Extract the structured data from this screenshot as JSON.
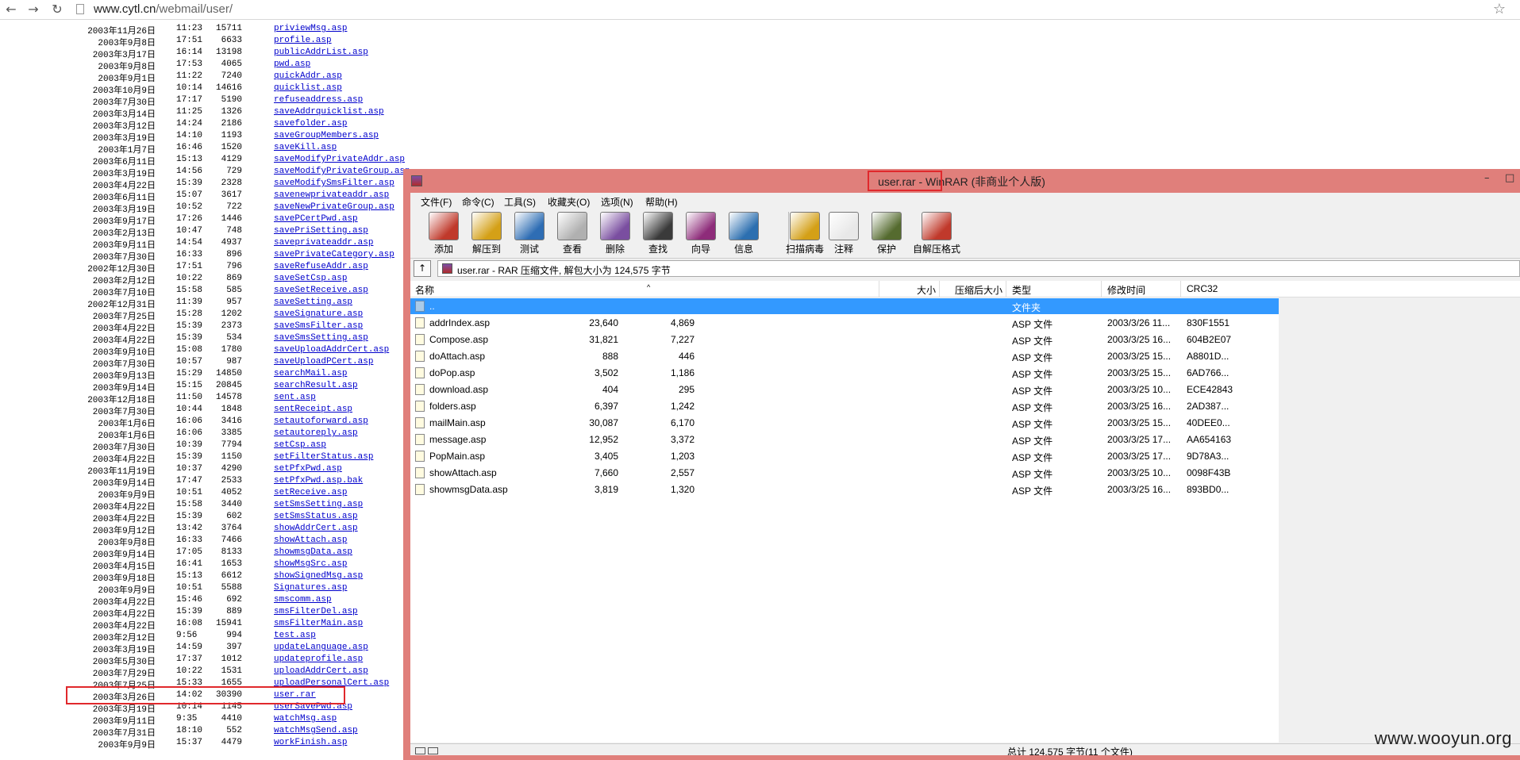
{
  "browser": {
    "url_host": "www.cytl.cn",
    "url_path": "/webmail/user/",
    "back_icon": "arrow-left",
    "forward_icon": "arrow-right",
    "reload_icon": "reload",
    "bookmark_icon": "star"
  },
  "listing": [
    {
      "date": "2003年11月26日",
      "time": "11:23",
      "size": "15711",
      "name": "priviewMsg.asp"
    },
    {
      "date": "2003年9月8日",
      "time": "17:51",
      "size": "6633",
      "name": "profile.asp"
    },
    {
      "date": "2003年3月17日",
      "time": "16:14",
      "size": "13198",
      "name": "publicAddrList.asp"
    },
    {
      "date": "2003年9月8日",
      "time": "17:53",
      "size": "4065",
      "name": "pwd.asp"
    },
    {
      "date": "2003年9月1日",
      "time": "11:22",
      "size": "7240",
      "name": "quickAddr.asp"
    },
    {
      "date": "2003年10月9日",
      "time": "10:14",
      "size": "14616",
      "name": "quicklist.asp"
    },
    {
      "date": "2003年7月30日",
      "time": "17:17",
      "size": "5190",
      "name": "refuseaddress.asp"
    },
    {
      "date": "2003年3月14日",
      "time": "11:25",
      "size": "1326",
      "name": "saveAddrquicklist.asp"
    },
    {
      "date": "2003年3月12日",
      "time": "14:24",
      "size": "2186",
      "name": "savefolder.asp"
    },
    {
      "date": "2003年3月19日",
      "time": "14:10",
      "size": "1193",
      "name": "saveGroupMembers.asp"
    },
    {
      "date": "2003年1月7日",
      "time": "16:46",
      "size": "1520",
      "name": "saveKill.asp"
    },
    {
      "date": "2003年6月11日",
      "time": "15:13",
      "size": "4129",
      "name": "saveModifyPrivateAddr.asp"
    },
    {
      "date": "2003年3月19日",
      "time": "14:56",
      "size": "729",
      "name": "saveModifyPrivateGroup.asp"
    },
    {
      "date": "2003年4月22日",
      "time": "15:39",
      "size": "2328",
      "name": "saveModifySmsFilter.asp"
    },
    {
      "date": "2003年6月11日",
      "time": "15:07",
      "size": "3617",
      "name": "savenewprivateaddr.asp"
    },
    {
      "date": "2003年3月19日",
      "time": "10:52",
      "size": "722",
      "name": "saveNewPrivateGroup.asp"
    },
    {
      "date": "2003年9月17日",
      "time": "17:26",
      "size": "1446",
      "name": "savePCertPwd.asp"
    },
    {
      "date": "2003年2月13日",
      "time": "10:47",
      "size": "748",
      "name": "savePriSetting.asp"
    },
    {
      "date": "2003年9月11日",
      "time": "14:54",
      "size": "4937",
      "name": "saveprivateaddr.asp"
    },
    {
      "date": "2003年7月30日",
      "time": "16:33",
      "size": "896",
      "name": "savePrivateCategory.asp"
    },
    {
      "date": "2002年12月30日",
      "time": "17:51",
      "size": "796",
      "name": "saveRefuseAddr.asp"
    },
    {
      "date": "2003年2月12日",
      "time": "10:22",
      "size": "869",
      "name": "saveSetCsp.asp"
    },
    {
      "date": "2003年7月10日",
      "time": "15:58",
      "size": "585",
      "name": "saveSetReceive.asp"
    },
    {
      "date": "2002年12月31日",
      "time": "11:39",
      "size": "957",
      "name": "saveSetting.asp"
    },
    {
      "date": "2003年7月25日",
      "time": "15:28",
      "size": "1202",
      "name": "saveSignature.asp"
    },
    {
      "date": "2003年4月22日",
      "time": "15:39",
      "size": "2373",
      "name": "saveSmsFilter.asp"
    },
    {
      "date": "2003年4月22日",
      "time": "15:39",
      "size": "534",
      "name": "saveSmsSetting.asp"
    },
    {
      "date": "2003年9月10日",
      "time": "15:08",
      "size": "1780",
      "name": "saveUploadAddrCert.asp"
    },
    {
      "date": "2003年7月30日",
      "time": "10:57",
      "size": "987",
      "name": "saveUploadPCert.asp"
    },
    {
      "date": "2003年9月13日",
      "time": "15:29",
      "size": "14850",
      "name": "searchMail.asp"
    },
    {
      "date": "2003年9月14日",
      "time": "15:15",
      "size": "20845",
      "name": "searchResult.asp"
    },
    {
      "date": "2003年12月18日",
      "time": "11:50",
      "size": "14578",
      "name": "sent.asp"
    },
    {
      "date": "2003年7月30日",
      "time": "10:44",
      "size": "1848",
      "name": "sentReceipt.asp"
    },
    {
      "date": "2003年1月6日",
      "time": "16:06",
      "size": "3416",
      "name": "setautoforward.asp"
    },
    {
      "date": "2003年1月6日",
      "time": "16:06",
      "size": "3385",
      "name": "setautoreply.asp"
    },
    {
      "date": "2003年7月30日",
      "time": "10:39",
      "size": "7794",
      "name": "setCsp.asp"
    },
    {
      "date": "2003年4月22日",
      "time": "15:39",
      "size": "1150",
      "name": "setFilterStatus.asp"
    },
    {
      "date": "2003年11月19日",
      "time": "10:37",
      "size": "4290",
      "name": "setPfxPwd.asp"
    },
    {
      "date": "2003年9月14日",
      "time": "17:47",
      "size": "2533",
      "name": "setPfxPwd.asp.bak"
    },
    {
      "date": "2003年9月9日",
      "time": "10:51",
      "size": "4052",
      "name": "setReceive.asp"
    },
    {
      "date": "2003年4月22日",
      "time": "15:58",
      "size": "3440",
      "name": "setSmsSetting.asp"
    },
    {
      "date": "2003年4月22日",
      "time": "15:39",
      "size": "602",
      "name": "setSmsStatus.asp"
    },
    {
      "date": "2003年9月12日",
      "time": "13:42",
      "size": "3764",
      "name": "showAddrCert.asp"
    },
    {
      "date": "2003年9月8日",
      "time": "16:33",
      "size": "7466",
      "name": "showAttach.asp"
    },
    {
      "date": "2003年9月14日",
      "time": "17:05",
      "size": "8133",
      "name": "showmsgData.asp"
    },
    {
      "date": "2003年4月15日",
      "time": "16:41",
      "size": "1653",
      "name": "showMsgSrc.asp"
    },
    {
      "date": "2003年9月18日",
      "time": "15:13",
      "size": "6612",
      "name": "showSignedMsg.asp"
    },
    {
      "date": "2003年9月9日",
      "time": "10:51",
      "size": "5588",
      "name": "Signatures.asp"
    },
    {
      "date": "2003年4月22日",
      "time": "15:46",
      "size": "692",
      "name": "smscomm.asp"
    },
    {
      "date": "2003年4月22日",
      "time": "15:39",
      "size": "889",
      "name": "smsFilterDel.asp"
    },
    {
      "date": "2003年4月22日",
      "time": "16:08",
      "size": "15941",
      "name": "smsFilterMain.asp"
    },
    {
      "date": "2003年2月12日",
      "time": "9:56",
      "size": "994",
      "name": "test.asp"
    },
    {
      "date": "2003年3月19日",
      "time": "14:59",
      "size": "397",
      "name": "updateLanguage.asp"
    },
    {
      "date": "2003年5月30日",
      "time": "17:37",
      "size": "1012",
      "name": "updateprofile.asp"
    },
    {
      "date": "2003年7月29日",
      "time": "10:22",
      "size": "1531",
      "name": "uploadAddrCert.asp"
    },
    {
      "date": "2003年7月25日",
      "time": "15:33",
      "size": "1655",
      "name": "uploadPersonalCert.asp"
    },
    {
      "date": "2003年3月26日",
      "time": "14:02",
      "size": "30390",
      "name": "user.rar"
    },
    {
      "date": "2003年3月19日",
      "time": "10:14",
      "size": "1145",
      "name": "userSavePwd.asp"
    },
    {
      "date": "2003年9月11日",
      "time": "9:35",
      "size": "4410",
      "name": "watchMsg.asp"
    },
    {
      "date": "2003年7月31日",
      "time": "18:10",
      "size": "552",
      "name": "watchMsgSend.asp"
    },
    {
      "date": "2003年9月9日",
      "time": "15:37",
      "size": "4479",
      "name": "workFinish.asp"
    }
  ],
  "winrar": {
    "title_file": "user.rar",
    "title_rest": " - WinRAR (非商业个人版)",
    "min_label": "–",
    "max_label": "□",
    "menu": [
      "文件(F)",
      "命令(C)",
      "工具(S)",
      "收藏夹(O)",
      "选项(N)",
      "帮助(H)"
    ],
    "tools": [
      {
        "label": "添加",
        "icon": "add-icon",
        "color": "#c0392b"
      },
      {
        "label": "解压到",
        "icon": "extract-to-icon",
        "color": "#d4a017"
      },
      {
        "label": "测试",
        "icon": "test-icon",
        "color": "#2e6db4"
      },
      {
        "label": "查看",
        "icon": "view-icon",
        "color": "#b0b0b0"
      },
      {
        "label": "删除",
        "icon": "delete-icon",
        "color": "#7a4ea0"
      },
      {
        "label": "查找",
        "icon": "find-icon",
        "color": "#3a3a3a"
      },
      {
        "label": "向导",
        "icon": "wizard-icon",
        "color": "#8e2c7a"
      },
      {
        "label": "信息",
        "icon": "info-icon",
        "color": "#2c6fb0"
      },
      {
        "label": "扫描病毒",
        "icon": "virus-scan-icon",
        "color": "#d4a017"
      },
      {
        "label": "注释",
        "icon": "comment-icon",
        "color": "#e8e8e8"
      },
      {
        "label": "保护",
        "icon": "protect-icon",
        "color": "#556b2f"
      },
      {
        "label": "自解压格式",
        "icon": "sfx-icon",
        "color": "#c0392b"
      }
    ],
    "path_text": "user.rar - RAR 压缩文件, 解包大小为 124,575 字节",
    "columns": {
      "name": "名称",
      "size": "大小",
      "packed": "压缩后大小",
      "type": "类型",
      "modified": "修改时间",
      "crc": "CRC32"
    },
    "parent_row": {
      "name": "..",
      "type": "文件夹"
    },
    "files": [
      {
        "name": "addrIndex.asp",
        "size": "23,640",
        "packed": "4,869",
        "type": "ASP 文件",
        "modified": "2003/3/26 11...",
        "crc": "830F1551"
      },
      {
        "name": "Compose.asp",
        "size": "31,821",
        "packed": "7,227",
        "type": "ASP 文件",
        "modified": "2003/3/25 16...",
        "crc": "604B2E07"
      },
      {
        "name": "doAttach.asp",
        "size": "888",
        "packed": "446",
        "type": "ASP 文件",
        "modified": "2003/3/25 15...",
        "crc": "A8801D..."
      },
      {
        "name": "doPop.asp",
        "size": "3,502",
        "packed": "1,186",
        "type": "ASP 文件",
        "modified": "2003/3/25 15...",
        "crc": "6AD766..."
      },
      {
        "name": "download.asp",
        "size": "404",
        "packed": "295",
        "type": "ASP 文件",
        "modified": "2003/3/25 10...",
        "crc": "ECE42843"
      },
      {
        "name": "folders.asp",
        "size": "6,397",
        "packed": "1,242",
        "type": "ASP 文件",
        "modified": "2003/3/25 16...",
        "crc": "2AD387..."
      },
      {
        "name": "mailMain.asp",
        "size": "30,087",
        "packed": "6,170",
        "type": "ASP 文件",
        "modified": "2003/3/25 15...",
        "crc": "40DEE0..."
      },
      {
        "name": "message.asp",
        "size": "12,952",
        "packed": "3,372",
        "type": "ASP 文件",
        "modified": "2003/3/25 17...",
        "crc": "AA654163"
      },
      {
        "name": "PopMain.asp",
        "size": "3,405",
        "packed": "1,203",
        "type": "ASP 文件",
        "modified": "2003/3/25 17...",
        "crc": "9D78A3..."
      },
      {
        "name": "showAttach.asp",
        "size": "7,660",
        "packed": "2,557",
        "type": "ASP 文件",
        "modified": "2003/3/25 10...",
        "crc": "0098F43B"
      },
      {
        "name": "showmsgData.asp",
        "size": "3,819",
        "packed": "1,320",
        "type": "ASP 文件",
        "modified": "2003/3/25 16...",
        "crc": "893BD0..."
      }
    ],
    "status_text": "总计 124,575 字节(11 个文件)"
  },
  "watermark": "www.wooyun.org"
}
